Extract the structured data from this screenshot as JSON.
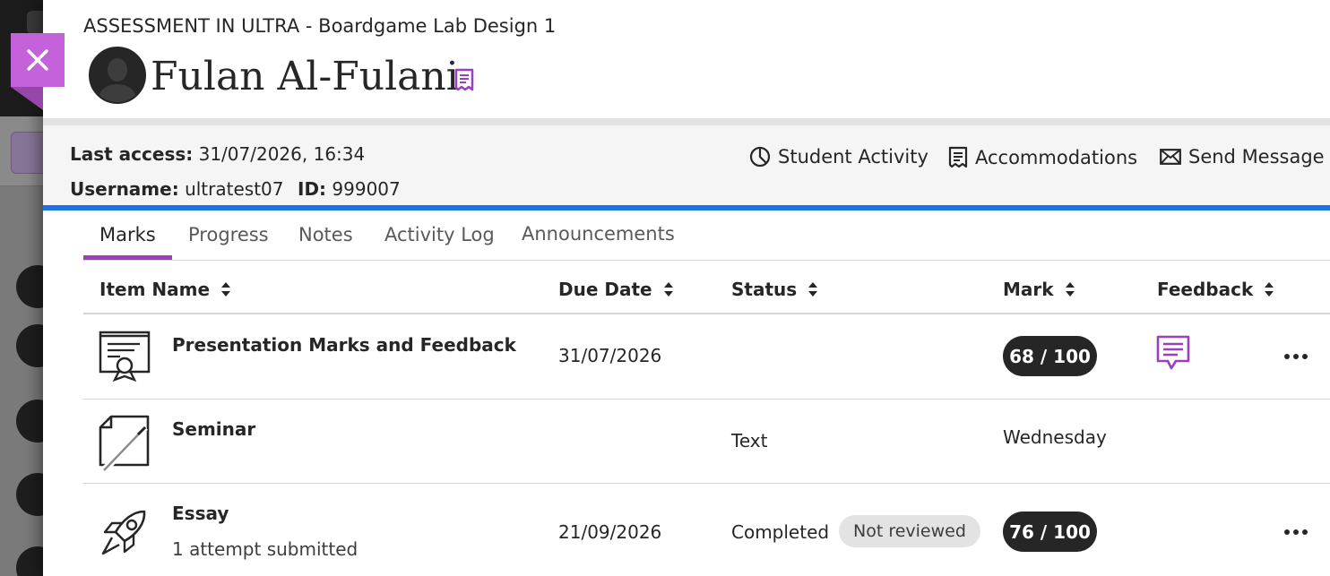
{
  "course": {
    "title": "ASSESSMENT IN ULTRA - Boardgame Lab Design 1"
  },
  "student": {
    "name": "Fulan Al-Fulani",
    "last_access_label": "Last access:",
    "last_access": "31/07/2026, 16:34",
    "username_label": "Username:",
    "username": "ultratest07",
    "id_label": "ID:",
    "id": "999007"
  },
  "actions": {
    "student_activity": "Student Activity",
    "accommodations": "Accommodations",
    "send_message": "Send Message"
  },
  "tabs": [
    {
      "label": "Marks",
      "active": true
    },
    {
      "label": "Progress",
      "active": false
    },
    {
      "label": "Notes",
      "active": false
    },
    {
      "label": "Activity Log",
      "active": false
    },
    {
      "label": "Announcements",
      "active": false
    }
  ],
  "table": {
    "columns": [
      "Item Name",
      "Due Date",
      "Status",
      "Mark",
      "Feedback"
    ],
    "rows": [
      {
        "icon": "presentation-icon",
        "name": "Presentation Marks and Feedback",
        "sub": "",
        "due": "31/07/2026",
        "status": "",
        "badge": "",
        "mark": "68 / 100",
        "feedback": true
      },
      {
        "icon": "paper-pen-icon",
        "name": "Seminar",
        "sub": "",
        "due": "",
        "status": "Text",
        "badge": "",
        "mark": "Wednesday",
        "feedback": false
      },
      {
        "icon": "rocket-icon",
        "name": "Essay",
        "sub": "1 attempt submitted",
        "due": "21/09/2026",
        "status": "Completed",
        "badge": "Not reviewed",
        "mark": "76 / 100",
        "feedback": false
      }
    ]
  },
  "colors": {
    "accent": "#9b3fbf",
    "close": "#c362da",
    "rule": "#1b74e4",
    "pill": "#262626"
  },
  "icons": [
    "close-icon",
    "person-avatar-icon",
    "accommodation-icon",
    "pie-chart-icon",
    "envelope-icon",
    "sort-icon",
    "feedback-icon",
    "more-icon"
  ]
}
